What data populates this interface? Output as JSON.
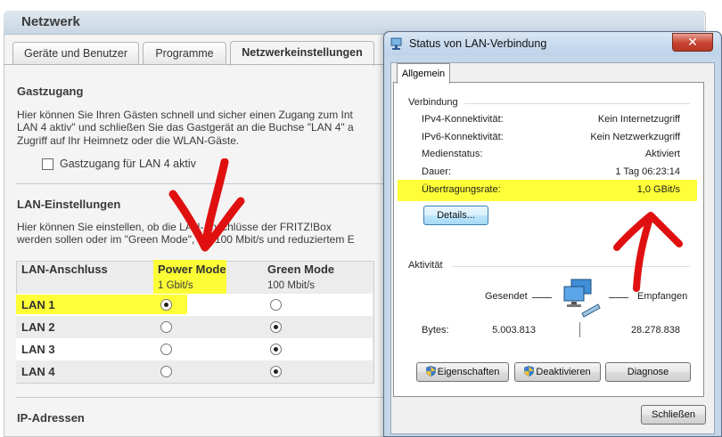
{
  "fritzbox": {
    "title": "Netzwerk",
    "tabs": [
      "Geräte und Benutzer",
      "Programme",
      "Netzwerkeinstellungen"
    ],
    "guest": {
      "heading": "Gastzugang",
      "text_line1": "Hier können Sie Ihren Gästen schnell und sicher einen Zugang zum Int",
      "text_line2": "LAN 4 aktiv\" und schließen Sie das Gastgerät an die Buchse \"LAN 4\" a",
      "text_line3": "Zugriff auf Ihr Heimnetz oder die WLAN-Gäste.",
      "checkbox_label": "Gastzugang für LAN 4 aktiv",
      "checkbox_checked": false
    },
    "lan": {
      "heading": "LAN-Einstellungen",
      "text_line1": "Hier können Sie einstellen, ob die LAN-Anschlüsse der FRITZ!Box",
      "text_line2": "werden sollen oder im \"Green Mode\", mit 100 Mbit/s und reduziertem E",
      "col_port": "LAN-Anschluss",
      "col_power": "Power Mode",
      "col_power_sub": "1 Gbit/s",
      "col_green": "Green Mode",
      "col_green_sub": "100 Mbit/s",
      "rows": [
        {
          "label": "LAN 1",
          "mode": "power"
        },
        {
          "label": "LAN 2",
          "mode": "green"
        },
        {
          "label": "LAN 3",
          "mode": "green"
        },
        {
          "label": "LAN 4",
          "mode": "green"
        }
      ]
    },
    "ip_heading": "IP-Adressen"
  },
  "dialog": {
    "title": "Status von LAN-Verbindung",
    "tab": "Allgemein",
    "connection": {
      "group": "Verbindung",
      "rows": [
        {
          "label": "IPv4-Konnektivität:",
          "value": "Kein Internetzugriff"
        },
        {
          "label": "IPv6-Konnektivität:",
          "value": "Kein Netzwerkzugriff"
        },
        {
          "label": "Medienstatus:",
          "value": "Aktiviert"
        },
        {
          "label": "Dauer:",
          "value": "1 Tag 06:23:14"
        },
        {
          "label": "Übertragungsrate:",
          "value": "1,0 GBit/s"
        }
      ],
      "details_button": "Details..."
    },
    "activity": {
      "group": "Aktivität",
      "sent_label": "Gesendet",
      "received_label": "Empfangen",
      "bytes_label": "Bytes:",
      "bytes_sent": "5.003.813",
      "bytes_received": "28.278.838"
    },
    "buttons": {
      "properties": "Eigenschaften",
      "deactivate": "Deaktivieren",
      "diagnose": "Diagnose",
      "close": "Schließen"
    },
    "close_glyph": "✕"
  },
  "colors": {
    "highlight": "#ffff22",
    "annotation": "#e01010"
  }
}
